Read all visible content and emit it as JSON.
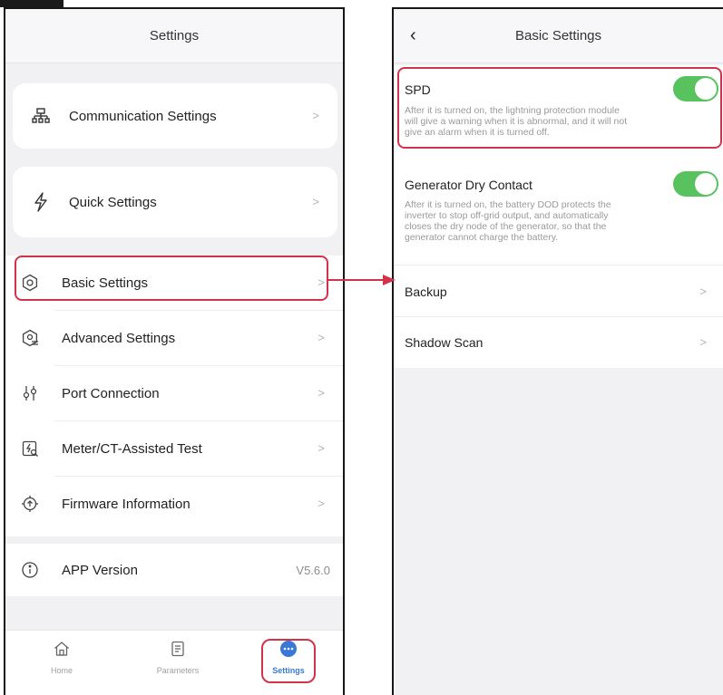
{
  "left_screen": {
    "title": "Settings",
    "card_items": [
      {
        "label": "Communication Settings",
        "icon": "network-icon"
      },
      {
        "label": "Quick Settings",
        "icon": "lightning-icon"
      }
    ],
    "list_items": [
      {
        "label": "Basic Settings",
        "icon": "gear-icon"
      },
      {
        "label": "Advanced Settings",
        "icon": "advanced-gear-icon"
      },
      {
        "label": "Port Connection",
        "icon": "port-icon"
      },
      {
        "label": "Meter/CT-Assisted Test",
        "icon": "meter-icon"
      },
      {
        "label": "Firmware Information",
        "icon": "firmware-icon"
      }
    ],
    "version": {
      "label": "APP Version",
      "value": "V5.6.0",
      "icon": "info-icon"
    },
    "tabs": [
      {
        "label": "Home",
        "icon": "home-icon"
      },
      {
        "label": "Parameters",
        "icon": "document-icon"
      },
      {
        "label": "Settings",
        "icon": "more-icon",
        "active": true
      }
    ]
  },
  "right_screen": {
    "title": "Basic Settings",
    "toggles": [
      {
        "label": "SPD",
        "on": true,
        "description": [
          "After it is turned on, the lightning protection module",
          "will give a warning when it is abnormal, and it will not",
          "give an alarm when it is turned off."
        ]
      },
      {
        "label": "Generator Dry Contact",
        "on": true,
        "description": [
          "After it is turned on, the battery DOD protects the",
          "inverter to stop off-grid output, and automatically",
          "closes the dry node of the generator, so that the",
          "generator cannot charge the battery."
        ]
      }
    ],
    "list_items": [
      {
        "label": "Backup"
      },
      {
        "label": "Shadow Scan"
      }
    ]
  },
  "colors": {
    "highlight": "#d3324b",
    "toggle_on": "#58c25e",
    "tab_active": "#3a78d8"
  }
}
